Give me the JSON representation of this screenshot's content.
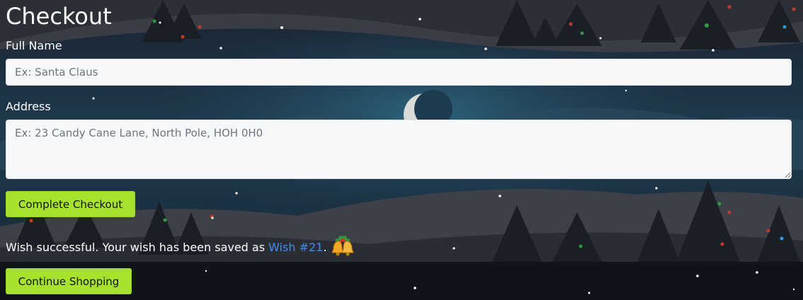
{
  "page": {
    "title": "Checkout"
  },
  "form": {
    "full_name_label": "Full Name",
    "full_name_placeholder": "Ex: Santa Claus",
    "full_name_value": "",
    "address_label": "Address",
    "address_placeholder": "Ex: 23 Candy Cane Lane, North Pole, HOH 0H0",
    "address_value": "",
    "submit_label": "Complete Checkout"
  },
  "result": {
    "message": "Wish successful. Your wish has been saved as",
    "wish_link_text": "Wish #21",
    "period": ".",
    "icon": "bells-icon"
  },
  "footer": {
    "continue_label": "Continue Shopping"
  },
  "colors": {
    "accent_button": "#a6e22e",
    "link": "#3d8ef0",
    "text": "#ffffff",
    "background": "#0d141c"
  }
}
